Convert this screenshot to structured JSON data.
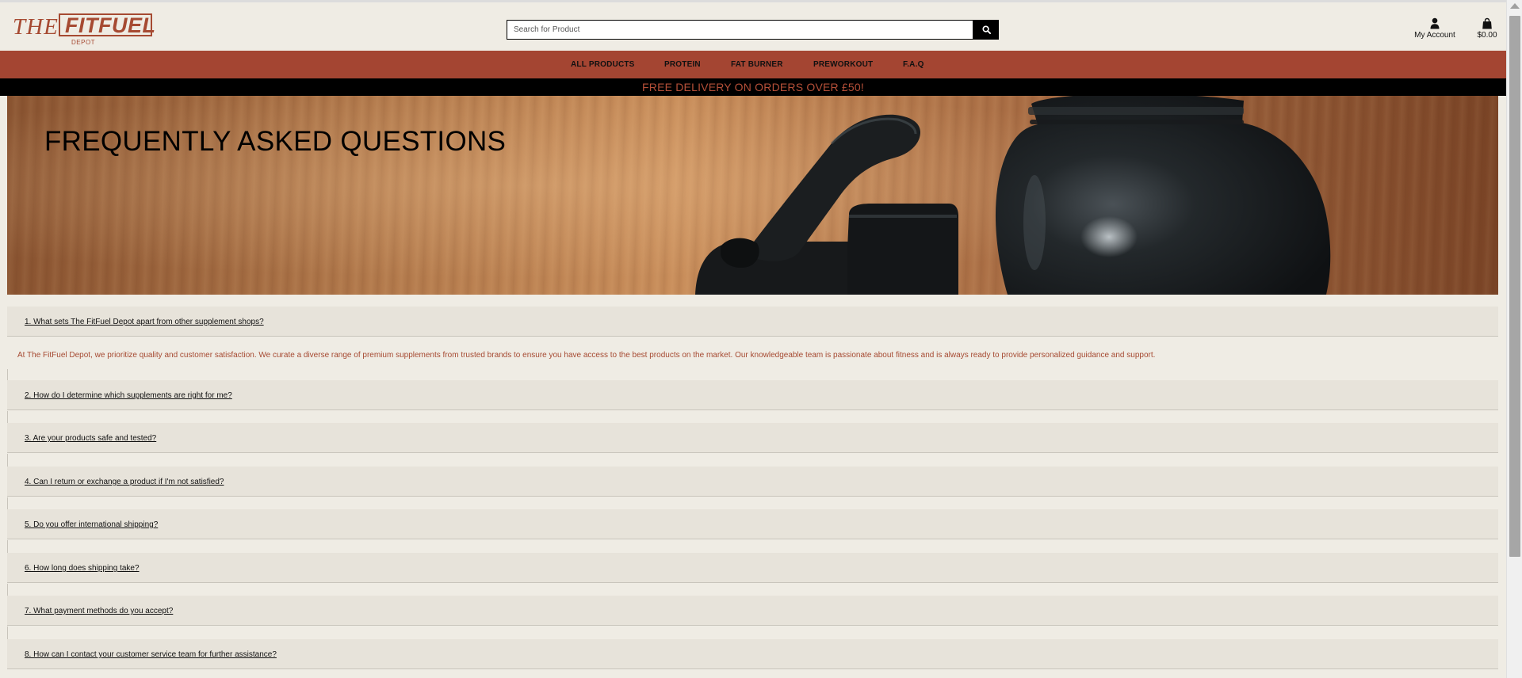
{
  "brand": {
    "logo_the": "THE",
    "logo_fitfuel": "FITFUEL",
    "logo_depot": "DEPOT",
    "color": "#a64a32"
  },
  "search": {
    "placeholder": "Search for Product",
    "button_icon": "search-icon"
  },
  "header_actions": {
    "account_label": "My Account",
    "account_icon": "user-icon",
    "cart_total": "$0.00",
    "cart_icon": "shopping-bag-icon"
  },
  "nav": {
    "items": [
      {
        "label": "ALL PRODUCTS"
      },
      {
        "label": "PROTEIN"
      },
      {
        "label": "FAT BURNER"
      },
      {
        "label": "PREWORKOUT"
      },
      {
        "label": "F.A.Q"
      }
    ],
    "background": "#a44532"
  },
  "promo": {
    "text": "FREE DELIVERY ON ORDERS OVER £50!",
    "color": "#b54f38"
  },
  "hero": {
    "title": "FREQUENTLY ASKED QUESTIONS"
  },
  "faq": {
    "questions": [
      "1. What sets The FitFuel Depot apart from other supplement shops?",
      "2. How do I determine which supplements are right for me?",
      "3. Are your products safe and tested?",
      "4. Can I return or exchange a product if I'm not satisfied?",
      "5. Do you offer international shipping?",
      "6. How long does shipping take?",
      "7. What payment methods do you accept?",
      "8. How can I contact your customer service team for further assistance?"
    ],
    "open_answer": "At The FitFuel Depot, we prioritize quality and customer satisfaction. We curate a diverse range of premium supplements from trusted brands to ensure you have access to the best products on the market. Our knowledgeable team is passionate about fitness and is always ready to provide personalized guidance and support.",
    "answer_color": "#a64a32"
  }
}
